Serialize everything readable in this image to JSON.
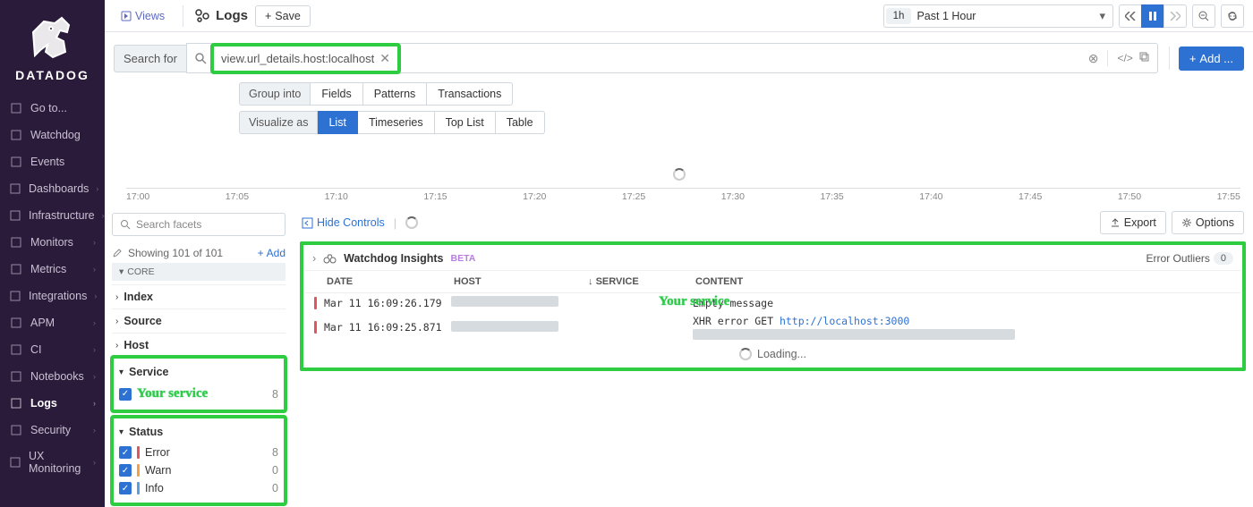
{
  "brand": "DATADOG",
  "nav": [
    {
      "label": "Go to...",
      "icon": "search",
      "chev": false
    },
    {
      "label": "Watchdog",
      "icon": "binoculars",
      "chev": false
    },
    {
      "label": "Events",
      "icon": "calendar",
      "chev": false
    },
    {
      "label": "Dashboards",
      "icon": "chart",
      "chev": true
    },
    {
      "label": "Infrastructure",
      "icon": "nodes",
      "chev": true
    },
    {
      "label": "Monitors",
      "icon": "monitor",
      "chev": true
    },
    {
      "label": "Metrics",
      "icon": "gauge",
      "chev": true
    },
    {
      "label": "Integrations",
      "icon": "plug",
      "chev": true
    },
    {
      "label": "APM",
      "icon": "lines",
      "chev": true
    },
    {
      "label": "CI",
      "icon": "infinity",
      "chev": true
    },
    {
      "label": "Notebooks",
      "icon": "book",
      "chev": true
    },
    {
      "label": "Logs",
      "icon": "logs",
      "chev": true,
      "active": true
    },
    {
      "label": "Security",
      "icon": "shield",
      "chev": true
    },
    {
      "label": "UX Monitoring",
      "icon": "pulse",
      "chev": true
    }
  ],
  "topbar": {
    "views": "Views",
    "title": "Logs",
    "save": "Save",
    "time_pill": "1h",
    "time_label": "Past 1 Hour",
    "add": "Add ..."
  },
  "search": {
    "label": "Search for",
    "tag": "view.url_details.host:localhost"
  },
  "group_into": {
    "label": "Group into",
    "options": [
      "Fields",
      "Patterns",
      "Transactions"
    ]
  },
  "visualize": {
    "label": "Visualize as",
    "options": [
      "List",
      "Timeseries",
      "Top List",
      "Table"
    ],
    "active": "List"
  },
  "chart_data": {
    "type": "bar",
    "categories": [
      "17:00",
      "17:05",
      "17:10",
      "17:15",
      "17:20",
      "17:25",
      "17:30",
      "17:35",
      "17:40",
      "17:45",
      "17:50",
      "17:55"
    ],
    "values": [],
    "title": "",
    "xlabel": "",
    "ylabel": ""
  },
  "facets": {
    "search_placeholder": "Search facets",
    "showing": "Showing 101 of 101",
    "add": "Add",
    "core": "CORE",
    "groups": [
      "Index",
      "Source",
      "Host"
    ],
    "service": {
      "label": "Service",
      "item_label": "Your service",
      "count": "8"
    },
    "status": {
      "label": "Status",
      "items": [
        {
          "label": "Error",
          "count": "8",
          "cls": "err"
        },
        {
          "label": "Warn",
          "count": "0",
          "cls": "warn"
        },
        {
          "label": "Info",
          "count": "0",
          "cls": "info"
        }
      ]
    }
  },
  "results": {
    "hide_controls": "Hide Controls",
    "export": "Export",
    "options": "Options",
    "insights_label": "Watchdog Insights",
    "insights_badge": "BETA",
    "error_outliers": "Error Outliers",
    "error_outliers_count": "0",
    "your_service_overlay": "Your service",
    "columns": {
      "date": "DATE",
      "host": "HOST",
      "service": "SERVICE",
      "content": "CONTENT"
    },
    "rows": [
      {
        "ts": "Mar 11 16:09:26.179",
        "content_plain": "Empty message",
        "url": ""
      },
      {
        "ts": "Mar 11 16:09:25.871",
        "content_plain": "XHR error GET ",
        "url": "http://localhost:3000"
      }
    ],
    "loading": "Loading..."
  }
}
